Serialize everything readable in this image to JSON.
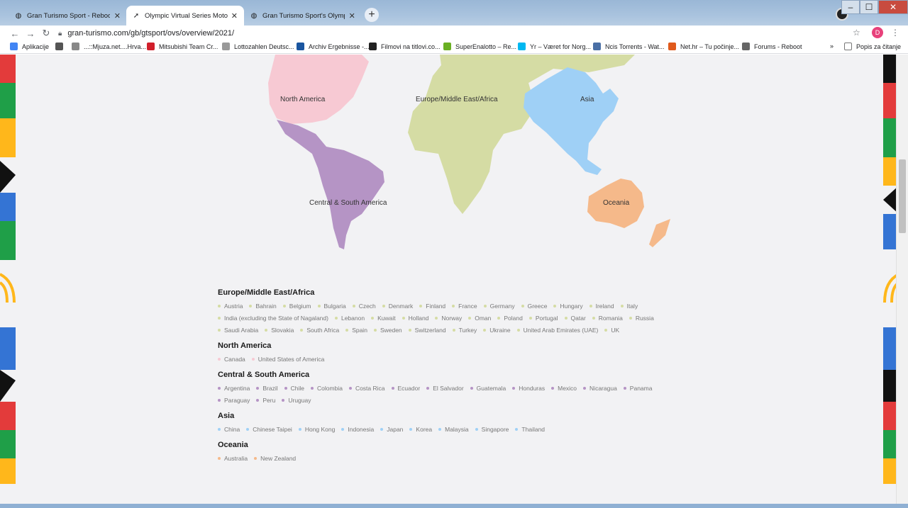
{
  "browser": {
    "tabs": [
      {
        "title": "Gran Turismo Sport - Reboot",
        "active": false,
        "icon": "globe-icon"
      },
      {
        "title": "Olympic Virtual Series Motor Sport",
        "active": true,
        "icon": "gt-logo-icon"
      },
      {
        "title": "Gran Turismo Sport's Olympic Tie",
        "active": false,
        "icon": "globe-icon"
      }
    ],
    "url": "gran-turismo.com/gb/gtsport/ovs/overview/2021/",
    "avatar_letter": "D",
    "bookmarks": [
      {
        "label": "Aplikacije",
        "icon": "apps-icon",
        "color": "#4285f4"
      },
      {
        "label": "",
        "icon": "info-icon",
        "color": "#555555"
      },
      {
        "label": "...::Mjuza.net....Hrva...",
        "icon": "music-icon",
        "color": "#888888"
      },
      {
        "label": "Mitsubishi Team Cr...",
        "icon": "mitsubishi-icon",
        "color": "#d11f2b"
      },
      {
        "label": "Lottozahlen Deutsc...",
        "icon": "lotto-icon",
        "color": "#999999"
      },
      {
        "label": "Archiv Ergebnisse -...",
        "icon": "archive-icon",
        "color": "#1a56a0"
      },
      {
        "label": "Filmovi na titlovi.co...",
        "icon": "film-icon",
        "color": "#222222"
      },
      {
        "label": "SuperEnalotto – Re...",
        "icon": "superenalotto-icon",
        "color": "#6ab023"
      },
      {
        "label": "Yr – Været for Norg...",
        "icon": "yr-icon",
        "color": "#00b8f1"
      },
      {
        "label": "Ncis Torrents - Wat...",
        "icon": "torrent-icon",
        "color": "#4a6fa5"
      },
      {
        "label": "Net.hr – Tu počinje...",
        "icon": "nethr-icon",
        "color": "#e05a1c"
      },
      {
        "label": "Forums - Reboot",
        "icon": "globe-icon",
        "color": "#666666"
      }
    ],
    "more_bookmarks": "»",
    "reading_list": "Popis za čitanje"
  },
  "map": {
    "labels": {
      "north_america": "North America",
      "europe": "Europe/Middle East/Africa",
      "asia": "Asia",
      "south_america": "Central & South America",
      "oceania": "Oceania"
    },
    "colors": {
      "north_america": "#f7c9d3",
      "europe": "#d5dca4",
      "asia": "#9fd0f6",
      "south_america": "#b594c5",
      "oceania": "#f5b98a"
    }
  },
  "regions": [
    {
      "title": "Europe/Middle East/Africa",
      "color": "#d5dca4",
      "countries": [
        "Austria",
        "Bahrain",
        "Belgium",
        "Bulgaria",
        "Czech",
        "Denmark",
        "Finland",
        "France",
        "Germany",
        "Greece",
        "Hungary",
        "Ireland",
        "Italy",
        "India (excluding the State of Nagaland)",
        "Lebanon",
        "Kuwait",
        "Holland",
        "Norway",
        "Oman",
        "Poland",
        "Portugal",
        "Qatar",
        "Romania",
        "Russia",
        "Saudi Arabia",
        "Slovakia",
        "South Africa",
        "Spain",
        "Sweden",
        "Switzerland",
        "Turkey",
        "Ukraine",
        "United Arab Emirates (UAE)",
        "UK"
      ]
    },
    {
      "title": "North America",
      "color": "#f7c9d3",
      "countries": [
        "Canada",
        "United States of America"
      ]
    },
    {
      "title": "Central & South America",
      "color": "#b594c5",
      "countries": [
        "Argentina",
        "Brazil",
        "Chile",
        "Colombia",
        "Costa Rica",
        "Ecuador",
        "El Salvador",
        "Guatemala",
        "Honduras",
        "Mexico",
        "Nicaragua",
        "Panama",
        "Paraguay",
        "Peru",
        "Uruguay"
      ]
    },
    {
      "title": "Asia",
      "color": "#9fd0f6",
      "countries": [
        "China",
        "Chinese Taipei",
        "Hong Kong",
        "Indonesia",
        "Japan",
        "Korea",
        "Malaysia",
        "Singapore",
        "Thailand"
      ]
    },
    {
      "title": "Oceania",
      "color": "#f5b98a",
      "countries": [
        "Australia",
        "New Zealand"
      ]
    }
  ]
}
